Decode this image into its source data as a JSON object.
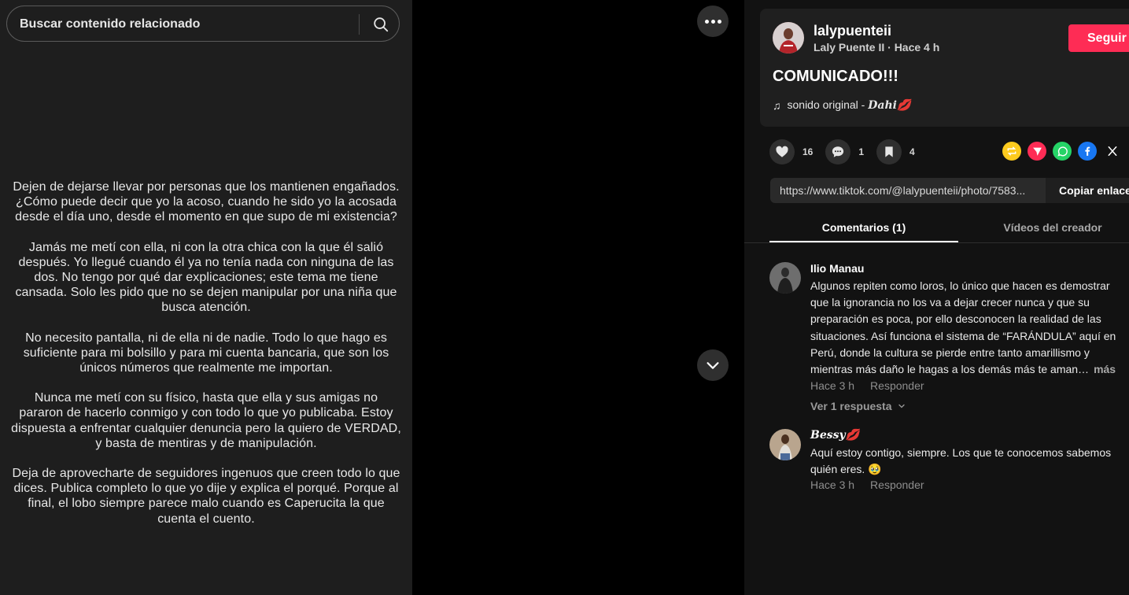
{
  "search": {
    "placeholder": "Buscar contenido relacionado"
  },
  "post_body": [
    "Dejen de dejarse llevar por personas que los mantienen engañados. ¿Cómo puede decir que yo la acoso, cuando he sido yo la acosada desde el día uno, desde el momento en que supo de mi existencia?",
    "Jamás me metí con ella, ni con la otra chica con la que él salió después. Yo llegué cuando él ya no tenía nada con ninguna de las dos. No tengo por qué dar explicaciones; este tema me tiene cansada. Solo les pido que no se dejen manipular por una niña que busca atención.",
    "No necesito pantalla, ni de ella ni de nadie. Todo lo que hago es suficiente para mi bolsillo y para mi cuenta bancaria, que son los únicos números que realmente me importan.",
    "Nunca me metí con su físico, hasta que ella y sus amigas no pararon de hacerlo conmigo y con todo lo que yo publicaba. Estoy dispuesta a enfrentar cualquier denuncia pero la quiero de VERDAD, y basta de mentiras y de manipulación.",
    "Deja de aprovecharte de seguidores ingenuos que creen todo lo que dices. Publica completo lo que yo dije y explica el porqué. Porque al final, el lobo siempre parece malo cuando es Caperucita la que cuenta el cuento."
  ],
  "author": {
    "username": "lalypuenteii",
    "display": "Laly Puente II · Hace 4 h",
    "follow_label": "Seguir"
  },
  "caption": "COMUNICADO!!!",
  "music": {
    "prefix": "sonido original - ",
    "artist": "𝑫𝒂𝒉𝒊💋"
  },
  "stats": {
    "likes": "16",
    "comments": "1",
    "saves": "4"
  },
  "share_icons": [
    "repost-icon",
    "send-icon",
    "whatsapp-icon",
    "facebook-icon",
    "x-icon"
  ],
  "link": {
    "url": "https://www.tiktok.com/@lalypuenteii/photo/7583...",
    "copy_label": "Copiar enlace"
  },
  "tabs": {
    "comments": "Comentarios (1)",
    "creator": "Vídeos del creador"
  },
  "comments": [
    {
      "name": "Ilio Manau",
      "text": "Algunos repiten como loros, lo único que hacen es demostrar que la ignorancia no los va a dejar crecer nunca y que su preparación es poca, por ello desconocen la realidad de las situaciones. Así funciona el sistema de “FARÁNDULA” aquí en Perú, donde la cultura se pierde entre tanto amarillismo y mientras más daño le hagas a los demás más te aman…",
      "more": "más",
      "time": "Hace 3 h",
      "reply": "Responder",
      "view_replies": "Ver 1 respuesta"
    },
    {
      "name": "𝑩𝒆𝒔𝒔𝒚💋",
      "text": "Aquí estoy contigo, siempre. Los que te conocemos sabemos quién eres. 🥹",
      "time": "Hace 3 h",
      "reply": "Responder"
    }
  ],
  "colors": {
    "accent": "#fe2c55",
    "panel": "#1f1f1f"
  }
}
